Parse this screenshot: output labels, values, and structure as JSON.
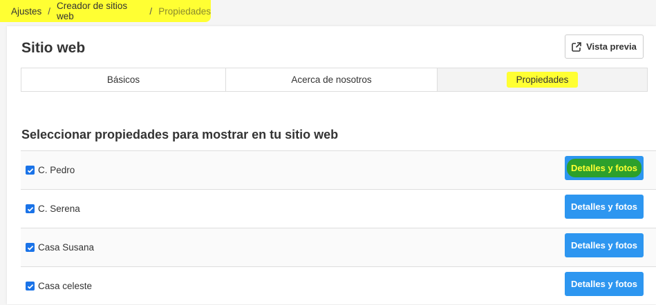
{
  "breadcrumb": {
    "items": [
      "Ajustes",
      "Creador de sitios web",
      "Propiedades"
    ],
    "separator": "/"
  },
  "page": {
    "title": "Sitio web",
    "preview_label": "Vista previa"
  },
  "tabs": [
    {
      "label": "Básicos",
      "active": false
    },
    {
      "label": "Acerca de nosotros",
      "active": false
    },
    {
      "label": "Propiedades",
      "active": true
    }
  ],
  "section": {
    "title": "Seleccionar propiedades para mostrar en tu sitio web"
  },
  "properties": [
    {
      "name": "C. Pedro",
      "checked": true,
      "button_label": "Detalles y fotos"
    },
    {
      "name": "C. Serena",
      "checked": true,
      "button_label": "Detalles y fotos"
    },
    {
      "name": "Casa Susana",
      "checked": true,
      "button_label": "Detalles y fotos"
    },
    {
      "name": "Casa celeste",
      "checked": true,
      "button_label": "Detalles y fotos"
    }
  ],
  "colors": {
    "accent": "#2d96f0",
    "highlight": "#ffff33",
    "checkbox": "#1a73e8"
  }
}
